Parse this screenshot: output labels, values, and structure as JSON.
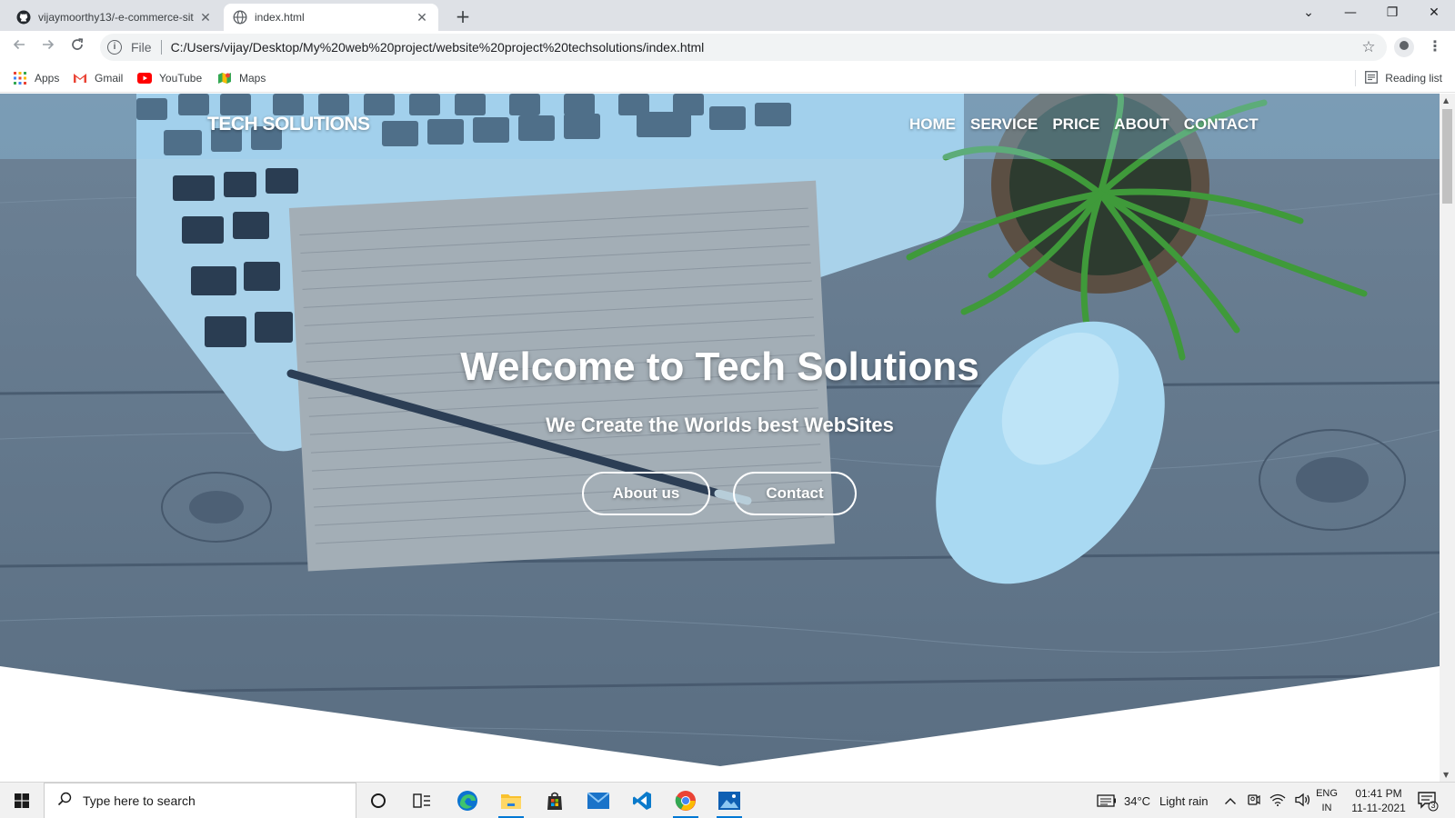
{
  "browser": {
    "tabs": [
      {
        "title": "vijaymoorthy13/-e-commerce-sit",
        "favicon": "github-icon",
        "active": false
      },
      {
        "title": "index.html",
        "favicon": "globe-icon",
        "active": true
      }
    ],
    "new_tab_glyph": "+",
    "window_controls": {
      "tab_search": "⌄",
      "minimize": "—",
      "restore": "❐",
      "close": "✕"
    },
    "address": {
      "scheme_label": "File",
      "url": "C:/Users/vijay/Desktop/My%20web%20project/website%20project%20techsolutions/index.html"
    },
    "bookmarks": [
      {
        "label": "Apps",
        "icon": "apps-grid-icon"
      },
      {
        "label": "Gmail",
        "icon": "gmail-icon"
      },
      {
        "label": "YouTube",
        "icon": "youtube-icon"
      },
      {
        "label": "Maps",
        "icon": "maps-icon"
      }
    ],
    "reading_list": "Reading list"
  },
  "site": {
    "logo": "TECH SOLUTIONS",
    "nav": [
      "HOME",
      "SERVICE",
      "PRICE",
      "ABOUT",
      "CONTACT"
    ],
    "hero": {
      "title": "Welcome to Tech Solutions",
      "subtitle": "We Create the Worlds best WebSites",
      "buttons": {
        "about": "About us",
        "contact": "Contact"
      }
    }
  },
  "taskbar": {
    "search_placeholder": "Type here to search",
    "pinned_apps": [
      "cortana-icon",
      "task-view-icon",
      "edge-icon",
      "file-explorer-icon",
      "store-icon",
      "mail-icon",
      "vscode-icon",
      "chrome-icon",
      "photos-icon"
    ],
    "weather": {
      "temp": "34°C",
      "condition": "Light rain"
    },
    "language": {
      "line1": "ENG",
      "line2": "IN"
    },
    "clock": {
      "time": "01:41 PM",
      "date": "11-11-2021"
    },
    "notification_count": "3"
  },
  "colors": {
    "tab_strip": "#dee1e6",
    "omnibox": "#f1f3f4",
    "hero_overlay": "#96cdf0",
    "taskbar": "#f1f1f1",
    "accent": "#0078d4"
  }
}
